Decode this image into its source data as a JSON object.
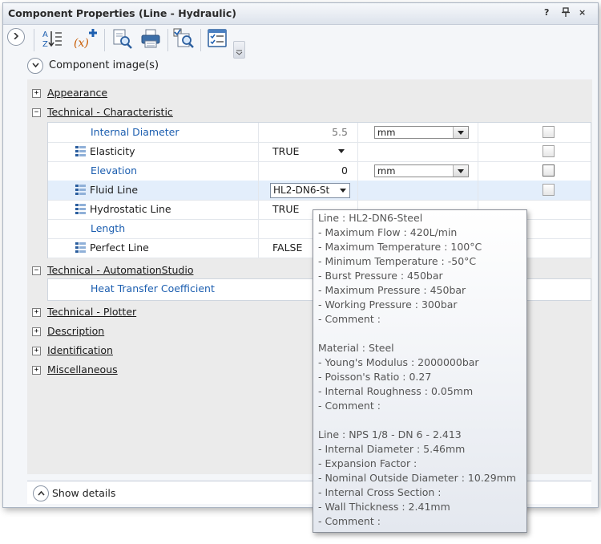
{
  "window": {
    "title": "Component Properties (Line - Hydraulic)",
    "help_label": "?",
    "pin_label": "↑",
    "close_label": "×"
  },
  "image_section": {
    "label": "Component image(s)"
  },
  "categories": {
    "appearance": "Appearance",
    "technical_characteristic": "Technical - Characteristic",
    "technical_automationstudio": "Technical - AutomationStudio",
    "technical_plotter": "Technical - Plotter",
    "description": "Description",
    "identification": "Identification",
    "miscellaneous": "Miscellaneous"
  },
  "characteristic_rows": [
    {
      "name": "Internal Diameter",
      "value": "5.5",
      "unit": "mm"
    },
    {
      "name": "Elasticity",
      "value": "TRUE"
    },
    {
      "name": "Elevation",
      "value": "0",
      "unit": "mm"
    },
    {
      "name": "Fluid Line",
      "value": "HL2-DN6-St"
    },
    {
      "name": "Hydrostatic Line",
      "value": "TRUE"
    },
    {
      "name": "Length",
      "value": ""
    },
    {
      "name": "Perfect Line",
      "value": "FALSE"
    }
  ],
  "automation_rows": [
    {
      "name": "Heat Transfer Coefficient"
    }
  ],
  "show_details": {
    "label": "Show details"
  },
  "tooltip": {
    "lines": [
      "Line : HL2-DN6-Steel",
      " - Maximum Flow : 420L/min",
      " - Maximum Temperature : 100°C",
      " - Minimum Temperature : -50°C",
      " - Burst Pressure : 450bar",
      " - Maximum Pressure : 450bar",
      " - Working Pressure : 300bar",
      " - Comment :",
      "",
      "Material : Steel",
      " - Young's Modulus : 2000000bar",
      " - Poisson's Ratio : 0.27",
      " - Internal Roughness : 0.05mm",
      " - Comment :",
      "",
      "Line : NPS 1/8 - DN 6 - 2.413",
      " - Internal Diameter : 5.46mm",
      " - Expansion Factor :",
      " - Nominal Outside Diameter : 10.29mm",
      " - Internal Cross Section :",
      " - Wall Thickness : 2.41mm",
      " - Comment :"
    ]
  },
  "colors": {
    "accent_blue": "#1d5fb0",
    "selected_row": "#e3eefb"
  }
}
